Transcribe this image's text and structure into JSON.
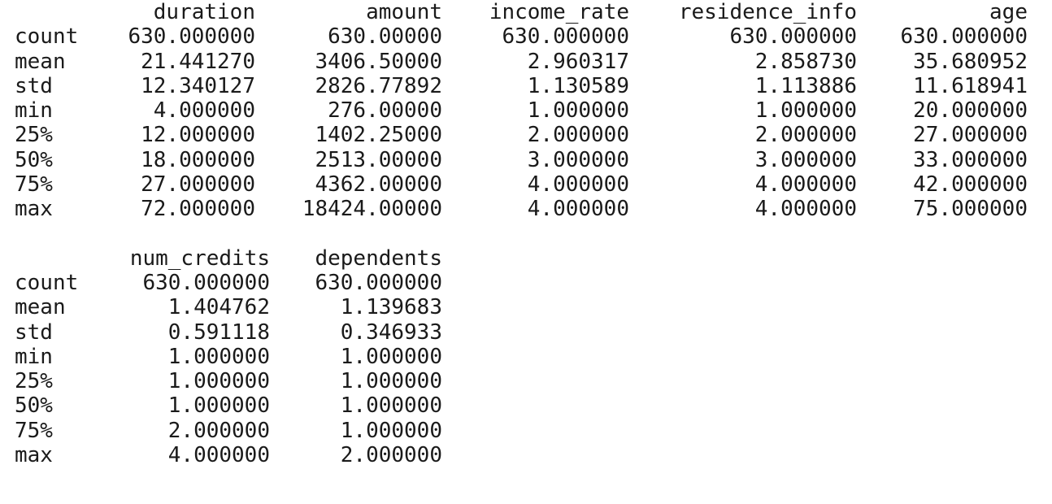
{
  "table1": {
    "columns": [
      "duration",
      "amount",
      "income_rate",
      "residence_info",
      "age"
    ],
    "rows": [
      {
        "label": "count",
        "values": [
          "630.000000",
          "630.00000",
          "630.000000",
          "630.000000",
          "630.000000"
        ]
      },
      {
        "label": "mean",
        "values": [
          "21.441270",
          "3406.50000",
          "2.960317",
          "2.858730",
          "35.680952"
        ]
      },
      {
        "label": "std",
        "values": [
          "12.340127",
          "2826.77892",
          "1.130589",
          "1.113886",
          "11.618941"
        ]
      },
      {
        "label": "min",
        "values": [
          "4.000000",
          "276.00000",
          "1.000000",
          "1.000000",
          "20.000000"
        ]
      },
      {
        "label": "25%",
        "values": [
          "12.000000",
          "1402.25000",
          "2.000000",
          "2.000000",
          "27.000000"
        ]
      },
      {
        "label": "50%",
        "values": [
          "18.000000",
          "2513.00000",
          "3.000000",
          "3.000000",
          "33.000000"
        ]
      },
      {
        "label": "75%",
        "values": [
          "27.000000",
          "4362.00000",
          "4.000000",
          "4.000000",
          "42.000000"
        ]
      },
      {
        "label": "max",
        "values": [
          "72.000000",
          "18424.00000",
          "4.000000",
          "4.000000",
          "75.000000"
        ]
      }
    ]
  },
  "table2": {
    "columns": [
      "num_credits",
      "dependents"
    ],
    "rows": [
      {
        "label": "count",
        "values": [
          "630.000000",
          "630.000000"
        ]
      },
      {
        "label": "mean",
        "values": [
          "1.404762",
          "1.139683"
        ]
      },
      {
        "label": "std",
        "values": [
          "0.591118",
          "0.346933"
        ]
      },
      {
        "label": "min",
        "values": [
          "1.000000",
          "1.000000"
        ]
      },
      {
        "label": "25%",
        "values": [
          "1.000000",
          "1.000000"
        ]
      },
      {
        "label": "50%",
        "values": [
          "1.000000",
          "1.000000"
        ]
      },
      {
        "label": "75%",
        "values": [
          "2.000000",
          "1.000000"
        ]
      },
      {
        "label": "max",
        "values": [
          "4.000000",
          "2.000000"
        ]
      }
    ]
  }
}
